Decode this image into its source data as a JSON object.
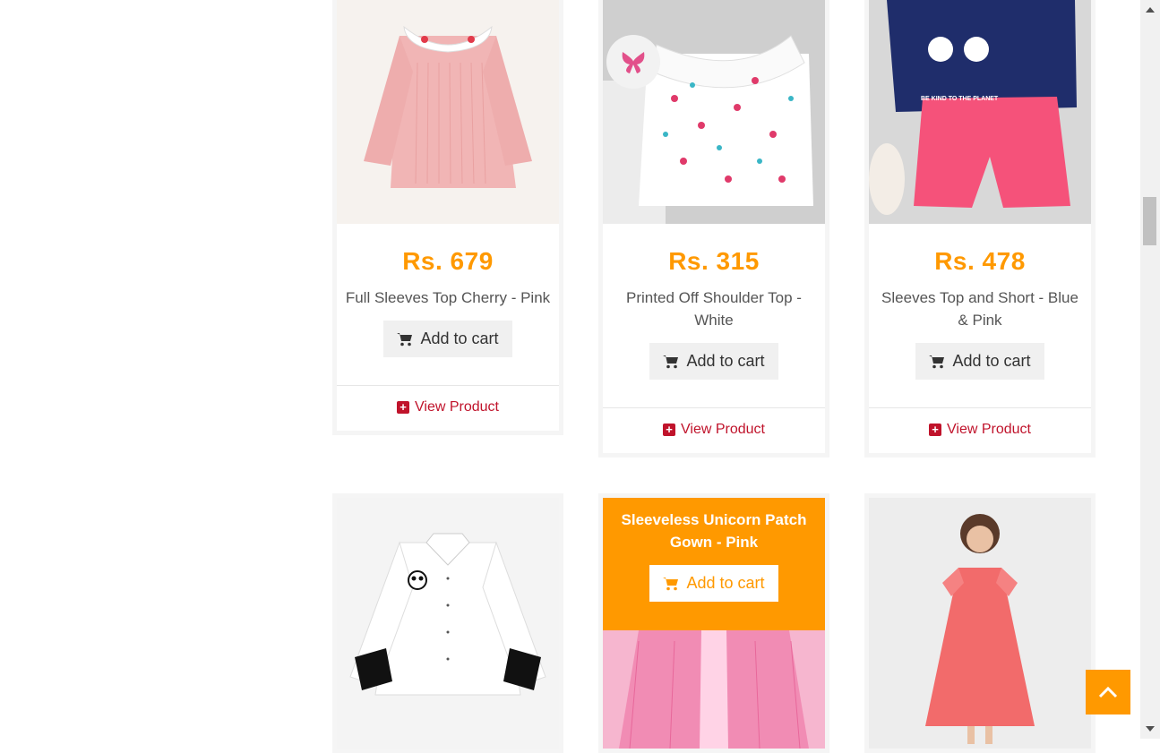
{
  "products": [
    {
      "price": "Rs. 679",
      "name": "Full Sleeves Top Cherry - Pink",
      "cart_label": "Add to cart",
      "view_label": "View Product"
    },
    {
      "price": "Rs. 315",
      "name": "Printed Off Shoulder Top - White",
      "cart_label": "Add to cart",
      "view_label": "View Product"
    },
    {
      "price": "Rs. 478",
      "name": "Sleeves Top and Short - Blue & Pink",
      "cart_label": "Add to cart",
      "view_label": "View Product"
    },
    {
      "name": "",
      "cart_label": "",
      "view_label": ""
    },
    {
      "name": "Sleeveless Unicorn Patch Gown - Pink",
      "cart_label": "Add to cart"
    },
    {
      "name": "",
      "cart_label": ""
    }
  ],
  "image_texts": {
    "tee_slogan": "BE KIND TO THE PLANET"
  },
  "colors": {
    "accent": "#ff9900",
    "link": "#c0132b"
  }
}
